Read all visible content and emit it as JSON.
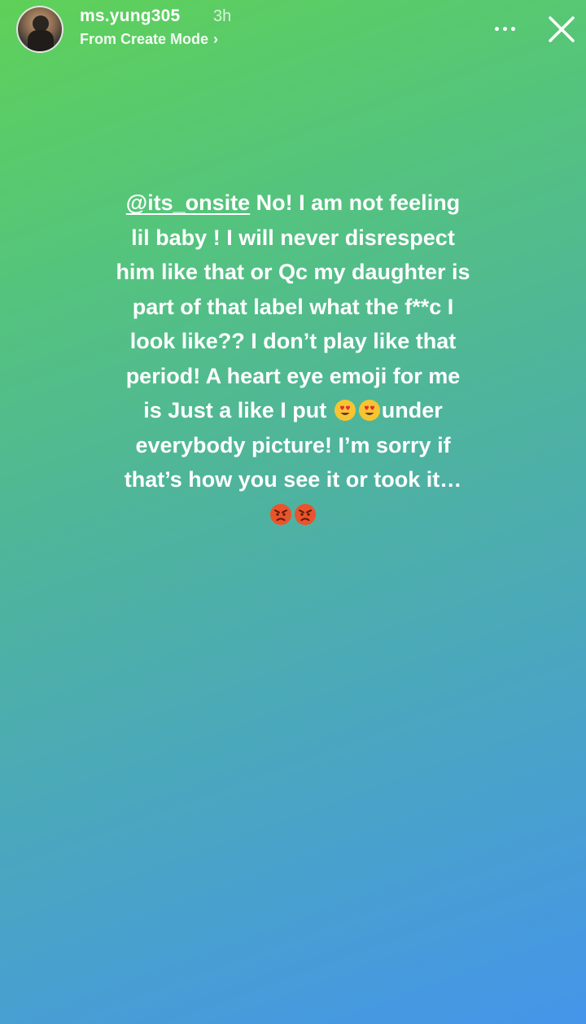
{
  "header": {
    "username": "ms.yung305",
    "time_ago": "3h",
    "subtitle": "From Create Mode",
    "subtitle_chevron": "›"
  },
  "story": {
    "mention": "@its_onsite",
    "text_part1": " No! I am not feeling lil baby ! I will never disrespect him like that or Qc my daughter is part of that label what the f**c  I look like?? I don’t play like that period! A heart eye emoji for me is Just a like I put ",
    "text_part2": "under everybody picture! I’m sorry if that’s how you see it or took it…",
    "emojis_inline": [
      "heart-eyes-emoji",
      "heart-eyes-emoji"
    ],
    "emojis_end": [
      "angry-face-emoji",
      "angry-face-emoji"
    ]
  },
  "icons": [
    "more-options-icon",
    "close-icon"
  ],
  "colors": {
    "gradient_start": "#5fd158",
    "gradient_end": "#4595ea",
    "text": "#ffffff"
  }
}
